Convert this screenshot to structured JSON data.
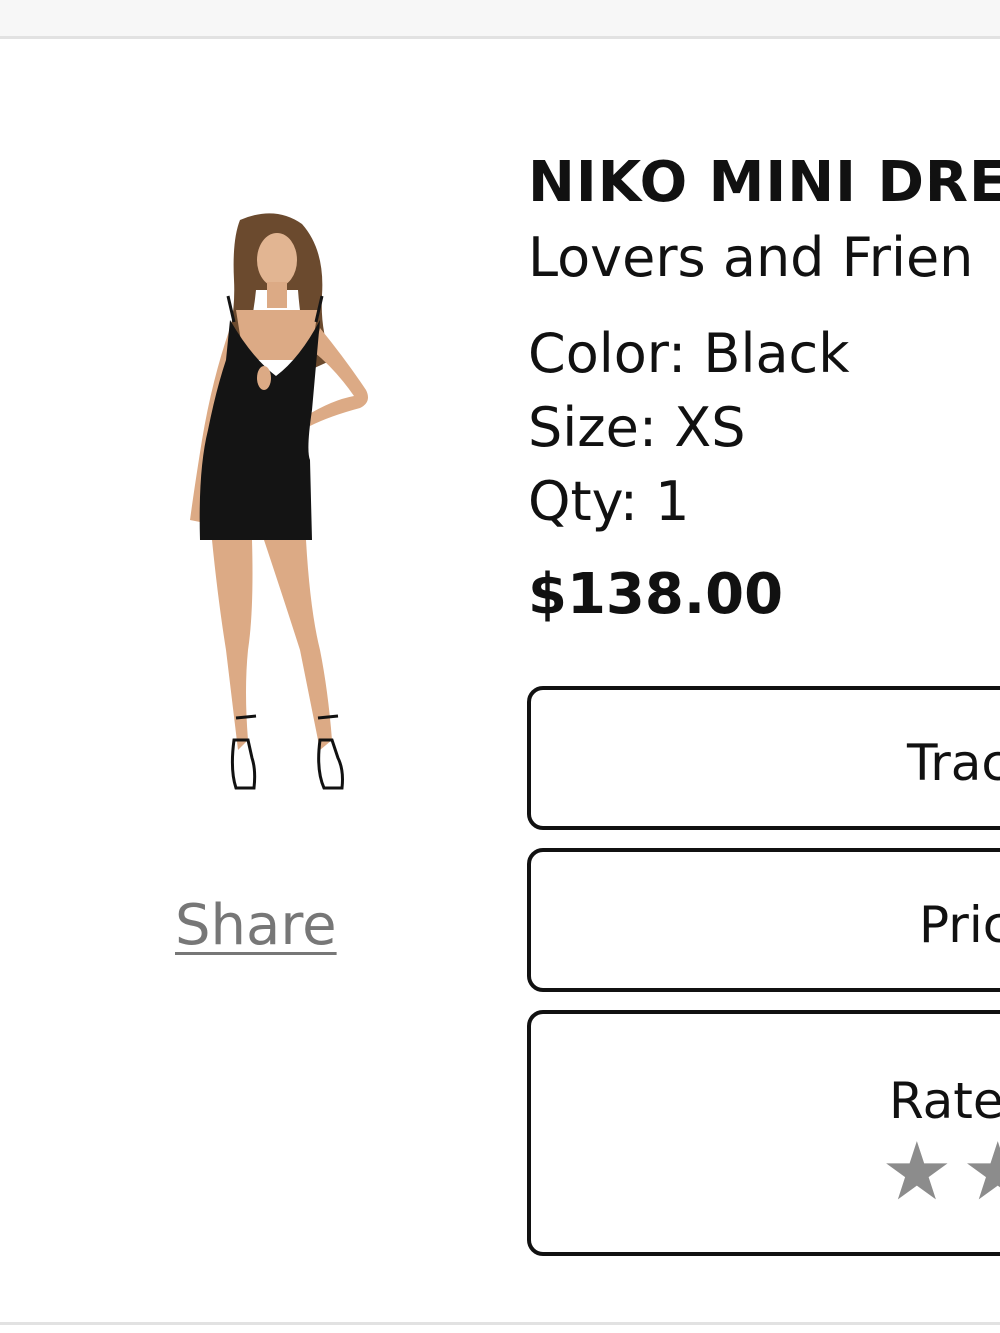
{
  "product": {
    "name": "NIKO MINI DRE",
    "brand": "Lovers and Frien",
    "color": "Color: Black",
    "size": "Size: XS",
    "qty": "Qty: 1",
    "price": "$138.00"
  },
  "share": {
    "label": "Share"
  },
  "actions": {
    "track_label": "Trac",
    "price_label": "Pric",
    "rate_label": "Rate"
  },
  "rating": {
    "value": 0,
    "max": 5,
    "star_icon": "star-icon",
    "star_color": "#8c8c8c"
  },
  "colors": {
    "text": "#111111",
    "share_link": "#777777",
    "divider": "#e2e2e2"
  }
}
